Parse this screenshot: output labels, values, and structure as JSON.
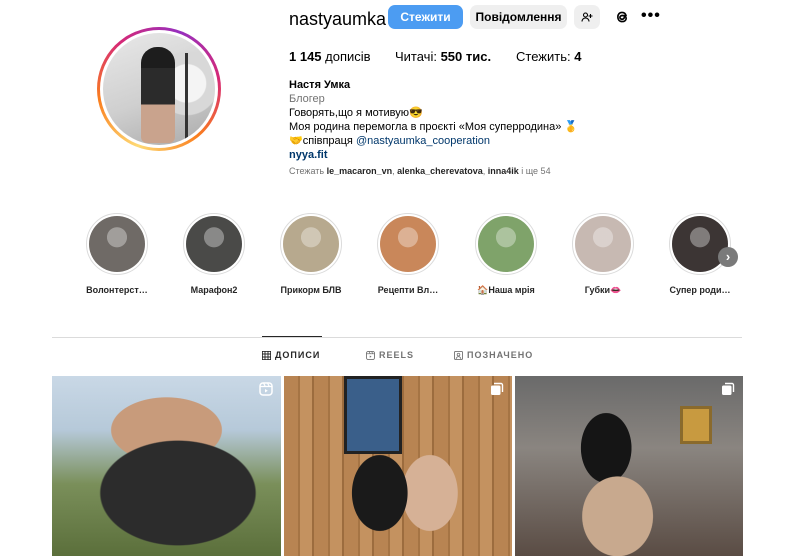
{
  "profile": {
    "username": "nastyaumka",
    "follow_label": "Стежити",
    "message_label": "Повідомлення",
    "stats": {
      "posts_value": "1 145",
      "posts_label": "дописів",
      "followers_label": "Читачі:",
      "followers_value": "550 тис.",
      "following_label": "Стежить:",
      "following_value": "4"
    },
    "bio": {
      "name": "Настя Умка",
      "category": "Блогер",
      "line1": "Говорять,що я мотивую😎",
      "line2": "Моя родина перемогла в проєкті «Моя суперродина» 🥇",
      "line3_prefix": "🤝співпраця ",
      "mention": "@nastyaumka_cooperation",
      "link": "nyya.fit"
    },
    "followed_by": {
      "prefix": "Стежать",
      "user1": "le_macaron_vn",
      "sep1": ", ",
      "user2": "alenka_cherevatova",
      "sep2": ", ",
      "user3": "inna4ik",
      "suffix": " і ще 54"
    }
  },
  "highlights": [
    {
      "label": "Волонтерст…",
      "color": "#6f6a66"
    },
    {
      "label": "Марафон2",
      "color": "#4a4a48"
    },
    {
      "label": "Прикорм БЛВ",
      "color": "#b7a98e"
    },
    {
      "label": "Рецепти Вл…",
      "color": "#c9875a"
    },
    {
      "label": "🏠Наша мрія",
      "color": "#7fa36a"
    },
    {
      "label": "Губки👄",
      "color": "#c7b9b2"
    },
    {
      "label": "Супер роди…",
      "color": "#3c3534"
    }
  ],
  "tabs": {
    "posts": "ДОПИСИ",
    "reels": "REELS",
    "tagged": "ПОЗНАЧЕНО"
  },
  "colors": {
    "accent": "#4c9cf2",
    "link": "#00376b"
  }
}
